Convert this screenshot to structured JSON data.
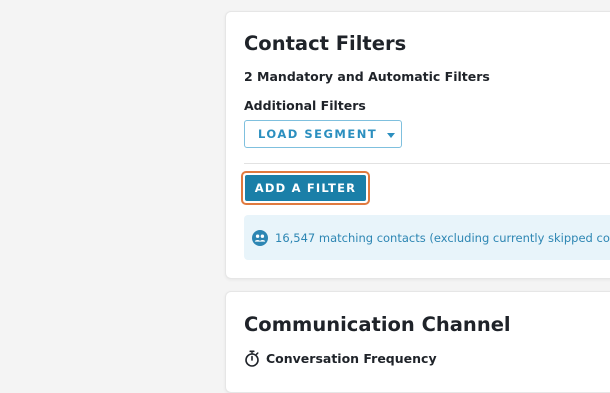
{
  "contact_filters": {
    "title": "Contact Filters",
    "mandatory_text": "2 Mandatory and Automatic Filters",
    "additional_label": "Additional Filters",
    "load_segment_label": "LOAD SEGMENT",
    "add_filter_label": "ADD A FILTER",
    "matching_text": "16,547 matching contacts (excluding currently skipped co"
  },
  "communication_channel": {
    "title": "Communication Channel",
    "frequency_label": "Conversation Frequency"
  },
  "icons": {
    "info": "contacts-group-icon",
    "frequency": "stopwatch-icon",
    "dropdown": "caret-down-icon"
  },
  "colors": {
    "primary": "#1a7fa8",
    "focus_ring": "#e07a3f",
    "info_bg": "#e8f4fa",
    "info_text": "#2d86b3"
  }
}
